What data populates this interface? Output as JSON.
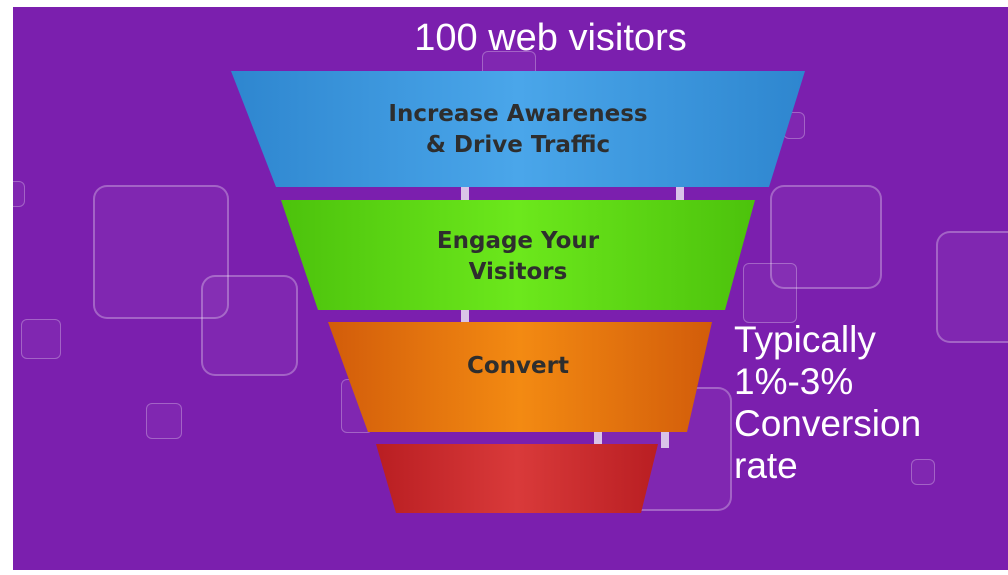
{
  "title": "100 web visitors",
  "funnel": {
    "stages": [
      {
        "lines": [
          "Increase Awareness",
          "& Drive Traffic"
        ],
        "color": "#3f9be0"
      },
      {
        "lines": [
          "Engage Your",
          "Visitors"
        ],
        "color": "#5fe215"
      },
      {
        "lines": [
          "Convert"
        ],
        "color": "#ef7a10"
      },
      {
        "lines": [],
        "color": "#d63232"
      }
    ]
  },
  "side_note": {
    "lines": [
      "Typically",
      "1%-3%",
      "Conversion",
      "rate"
    ]
  },
  "colors": {
    "background": "#7b1fae",
    "text_light": "#ffffff",
    "text_dark": "#2e2e2e"
  }
}
